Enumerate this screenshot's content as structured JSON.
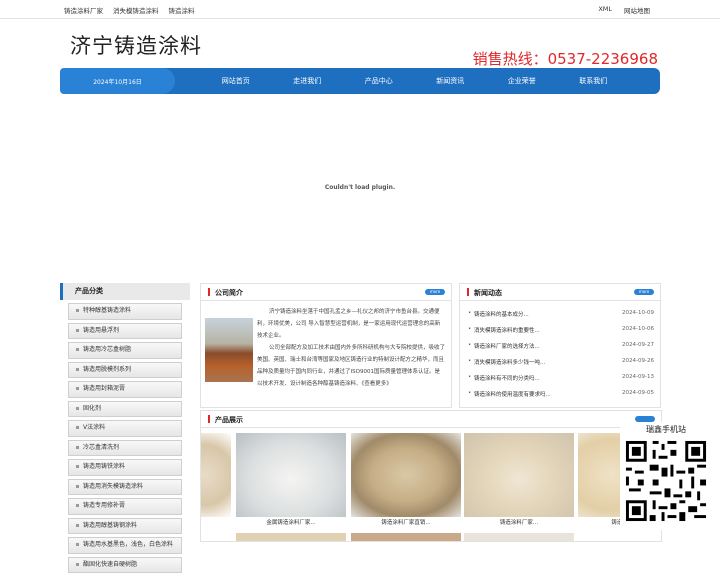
{
  "topbar": {
    "links": [
      "铸造涂料厂家",
      "消失模铸造涂料",
      "铸造涂料"
    ],
    "right_links": [
      "XML",
      "网站地图"
    ]
  },
  "header": {
    "logo": "济宁铸造涂料",
    "hotline": "销售热线：0537-2236968"
  },
  "nav": {
    "date": "2024年10月16日",
    "items": [
      "网站首页",
      "走进我们",
      "产品中心",
      "新闻资讯",
      "企业荣誉",
      "联系我们"
    ]
  },
  "plugin": {
    "message": "Couldn't load plugin."
  },
  "sidebar": {
    "title": "产品分类",
    "items": [
      "特种醇基铸造涂料",
      "铸造用悬浮剂",
      "铸造用冷芯盒树脂",
      "铸造用脱模剂系列",
      "铸造用封箱泥膏",
      "固化剂",
      "V法涂料",
      "冷芯盒清洗剂",
      "铸造用铸铁涂料",
      "铸造用消失模铸造涂料",
      "铸造专用修补膏",
      "铸造用醇基铸钢涂料",
      "铸造用水基黑色，浅色，白色涂料",
      "酯固化快速自硬树脂"
    ]
  },
  "intro": {
    "title": "公司简介",
    "more": "more",
    "p1": "济宁铸造涂料坐落于中国孔孟之乡—礼仪之邦的济宁市鱼台县。交通便利，环境优美，公司 导入智慧型运营机制，是一家运用现代运营理念的高新技术企业。",
    "p2": "公司全部配方及加工技术由国内外多所科研机构与大专院校提供，吸收了美国、英国、瑞士和台湾等国家及地区铸造行业的特制设计配方之精华，而且品种及质量均于国内同行业，并通过了ISO9001国际质量管理体系认证。是以技术开发、设计制造各种醇基铸造涂料、《查看更多》"
  },
  "news": {
    "title": "新闻动态",
    "more": "more",
    "rows": [
      {
        "title": "铸造涂料的基本成分...",
        "date": "2024-10-09"
      },
      {
        "title": "消失模铸造涂料的重要性...",
        "date": "2024-10-06"
      },
      {
        "title": "铸造涂料厂家的选择方法...",
        "date": "2024-09-27"
      },
      {
        "title": "消失模铸造涂料多少钱一吨...",
        "date": "2024-09-26"
      },
      {
        "title": "铸造涂料有不同的分类吗...",
        "date": "2024-09-13"
      },
      {
        "title": "铸造涂料的使用温度有要求吗...",
        "date": "2024-09-05"
      }
    ]
  },
  "products": {
    "title": "产品展示",
    "items": [
      "金属铸造涂料厂家...",
      "铸造涂料厂家直销...",
      "铸造涂料厂家...",
      "铸造..."
    ]
  },
  "qr": {
    "label": "瑞鑫手机站"
  },
  "colors": {
    "nav": "#1f6fc0",
    "accent_red": "#e0282a"
  }
}
